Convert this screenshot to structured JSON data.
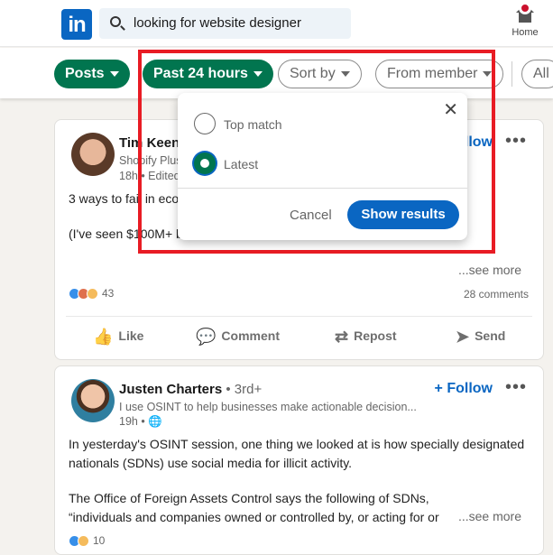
{
  "header": {
    "logo": "in",
    "search_value": "looking for website designer",
    "home_label": "Home"
  },
  "filters": [
    {
      "label": "Posts",
      "active": true
    },
    {
      "label": "Past 24 hours",
      "active": true
    },
    {
      "label": "Sort by",
      "active": false
    },
    {
      "label": "From member",
      "active": false
    },
    {
      "label": "All",
      "active": false
    }
  ],
  "dropdown": {
    "options": [
      {
        "label": "Top match",
        "selected": false
      },
      {
        "label": "Latest",
        "selected": true
      }
    ],
    "cancel": "Cancel",
    "show_results": "Show results"
  },
  "posts": [
    {
      "name": "Tim Keen",
      "degree": "•",
      "headline": "Shopify Plus",
      "meta": "18h • Edited",
      "follow": "Follow",
      "text1": "3 ways to fail in eco",
      "text2": "(I've seen $100M+ b",
      "see_more": "...see more",
      "reactions": "43",
      "comments": "28 comments"
    },
    {
      "name": "Justen Charters",
      "degree": "• 3rd+",
      "headline": "I use OSINT to help businesses make actionable decision...",
      "meta": "19h •",
      "follow": "+ Follow",
      "text1": "In yesterday's OSINT session, one thing we looked at is how specially designated nationals (SDNs) use social media for illicit activity.",
      "text2": "The Office of Foreign Assets Control says the following of SDNs, “individuals and companies owned or controlled by, or acting for or on behalf of, targ",
      "see_more": "...see more",
      "reactions": "10"
    }
  ],
  "actions": {
    "like": "Like",
    "comment": "Comment",
    "repost": "Repost",
    "send": "Send"
  },
  "colors": {
    "accent": "#0a66c2",
    "green": "#01754f",
    "highlight": "#e81c24"
  }
}
